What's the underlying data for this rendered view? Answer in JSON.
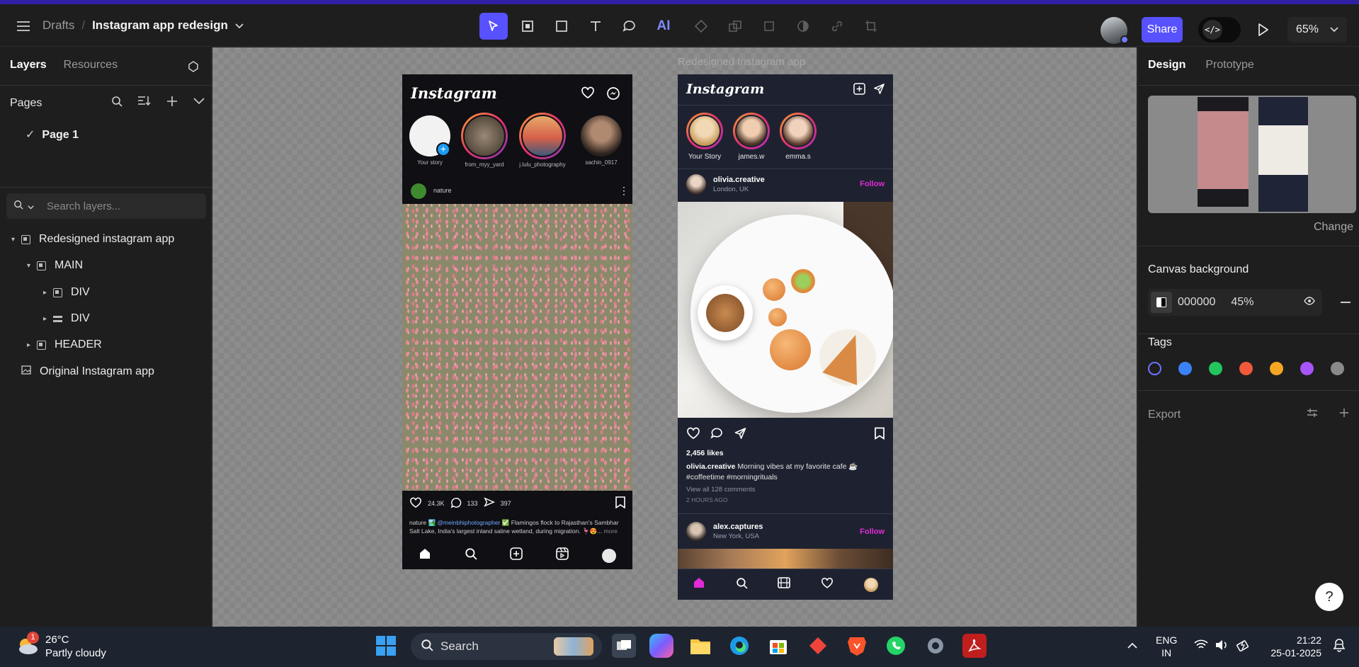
{
  "breadcrumb": {
    "parent": "Drafts",
    "file": "Instagram app redesign"
  },
  "toolbar": {
    "ai_label": "AI",
    "share": "Share",
    "zoom": "65%"
  },
  "left_panel": {
    "tabs": [
      "Layers",
      "Resources"
    ],
    "pages_title": "Pages",
    "page_name": "Page 1",
    "search_placeholder": "Search layers...",
    "layers": [
      {
        "name": "Redesigned instagram app"
      },
      {
        "name": "MAIN"
      },
      {
        "name": "DIV"
      },
      {
        "name": "DIV"
      },
      {
        "name": "HEADER"
      },
      {
        "name": "Original Instagram app"
      }
    ]
  },
  "canvas": {
    "frame_label": "Redesigned Instagram app",
    "original": {
      "logo": "Instagram",
      "stories": [
        "Your story",
        "from_myy_yard",
        "j.lulu_photography",
        "sachin_0917"
      ],
      "post_user": "nature",
      "likes": "24.3K",
      "comments": "133",
      "shares": "397",
      "caption_user": "nature 🏞️",
      "caption_tag": "@meinbhiphotographer",
      "caption_text": "✅ Flamingos flock to Rajasthan's Sambhar Salt Lake, India's largest inland saline wetland, during migration. 🦩😍...",
      "caption_more": "more"
    },
    "redesigned": {
      "logo": "Instagram",
      "stories": [
        "Your Story",
        "james.w",
        "emma.s"
      ],
      "post1": {
        "user": "olivia.creative",
        "location": "London, UK",
        "follow": "Follow"
      },
      "likes": "2,456 likes",
      "caption_user": "olivia.creative",
      "caption_text": "Morning vibes at my favorite cafe ☕ #coffeetime #morningrituals",
      "view_comments": "View all 128 comments",
      "time": "2 HOURS AGO",
      "post2": {
        "user": "alex.captures",
        "location": "New York, USA",
        "follow": "Follow"
      }
    }
  },
  "right_panel": {
    "tabs": [
      "Design",
      "Prototype"
    ],
    "change": "Change",
    "canvas_bg_title": "Canvas background",
    "bg_hex": "000000",
    "bg_opacity": "45%",
    "tags_title": "Tags",
    "tag_colors": [
      "#1e1e1e",
      "#3b82f6",
      "#22c55e",
      "#f05a3a",
      "#f5a623",
      "#a855f7",
      "#8a8a8a"
    ],
    "export_title": "Export"
  },
  "taskbar": {
    "temp": "26°C",
    "weather": "Partly cloudy",
    "weather_badge": "1",
    "search": "Search",
    "lang1": "ENG",
    "lang2": "IN",
    "time": "21:22",
    "date": "25-01-2025"
  },
  "help": "?"
}
